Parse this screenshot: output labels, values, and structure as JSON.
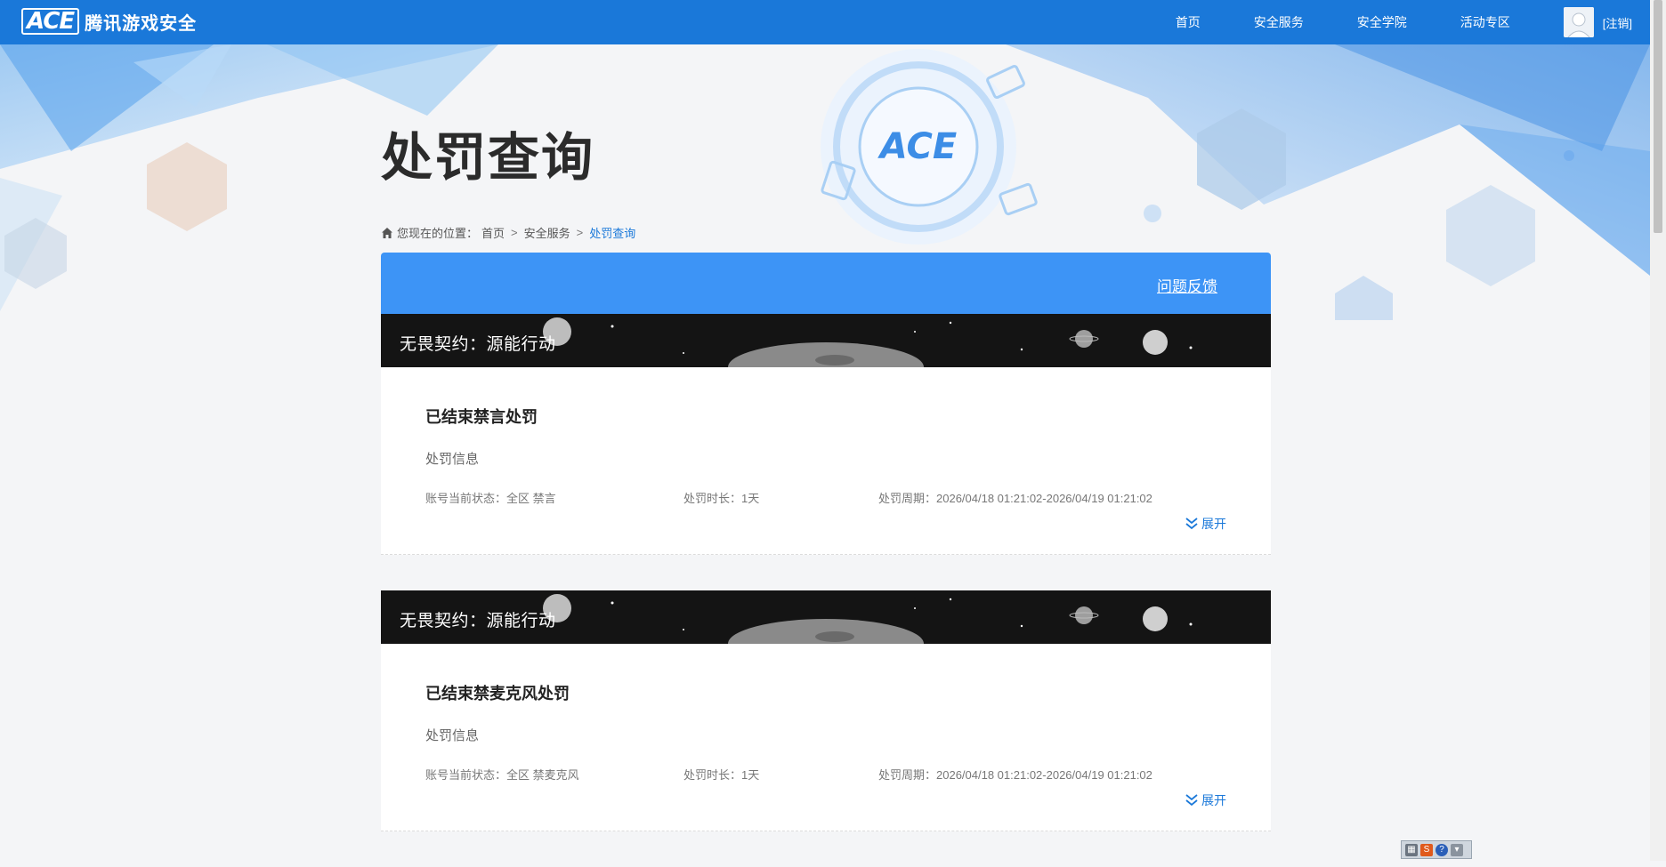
{
  "header": {
    "logo_mark": "ACE",
    "logo_text": "腾讯游戏安全",
    "nav": [
      "首页",
      "安全服务",
      "安全学院",
      "活动专区"
    ],
    "logout": "[注销]"
  },
  "page": {
    "title": "处罚查询",
    "breadcrumb": {
      "prefix": "您现在的位置：",
      "items": [
        "首页",
        "安全服务"
      ],
      "current": "处罚查询",
      "separator": ">"
    },
    "feedback": "问题反馈"
  },
  "cards": [
    {
      "game": "无畏契约：源能行动",
      "title": "已结束禁言处罚",
      "info_label": "处罚信息",
      "status": "账号当前状态：全区 禁言",
      "duration": "处罚时长：1天",
      "period": "处罚周期：2026/04/18 01:21:02-2026/04/19 01:21:02",
      "expand": "展开"
    },
    {
      "game": "无畏契约：源能行动",
      "title": "已结束禁麦克风处罚",
      "info_label": "处罚信息",
      "status": "账号当前状态：全区 禁麦克风",
      "duration": "处罚时长：1天",
      "period": "处罚周期：2026/04/18 01:21:02-2026/04/19 01:21:02",
      "expand": "展开"
    }
  ],
  "colors": {
    "nav_bg": "#1a78d9",
    "panel_head": "#3d94f6",
    "link": "#1a78d9"
  },
  "icons": [
    "home-icon",
    "chevron-double-down-icon",
    "avatar-icon"
  ]
}
